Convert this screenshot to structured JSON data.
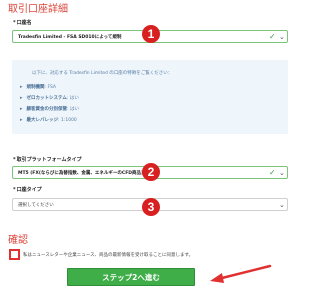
{
  "account_section": {
    "title": "取引口座詳細",
    "account_name": {
      "label": "口座名",
      "value": "Tradesfin Limited - FSA SD010によって規制"
    },
    "info": {
      "intro": "以下に、対応する Tradesfin Limited の口座の特徴をご覧ください：",
      "items": [
        {
          "key": "規制機関",
          "value": "FSA"
        },
        {
          "key": "ゼロカットシステム",
          "value": "はい"
        },
        {
          "key": "顧客資金の分別保管",
          "value": "はい"
        },
        {
          "key": "最大レバレッジ",
          "value": "1:1000"
        }
      ]
    },
    "platform": {
      "label": "取引プラットフォームタイプ",
      "value": "MT5 (FX(ならびに為替指数、金属、エネルギーのCFD商品)"
    },
    "account_type": {
      "label": "口座タイプ",
      "value": "選択してください"
    }
  },
  "confirm_section": {
    "title": "確認",
    "consent_text": "私はニュースレターや企業ニュース、商品の最新情報を受け取ることに同意します。",
    "next_button": "ステップ2へ進む"
  },
  "annotations": {
    "badges": [
      "1",
      "2",
      "3"
    ],
    "badge_color": "#d92020",
    "arrow_color": "#e03030"
  },
  "colors": {
    "accent": "#d9453a",
    "button": "#3fae49",
    "valid_check": "#3aa04a",
    "info_bg": "#eef5fb"
  }
}
